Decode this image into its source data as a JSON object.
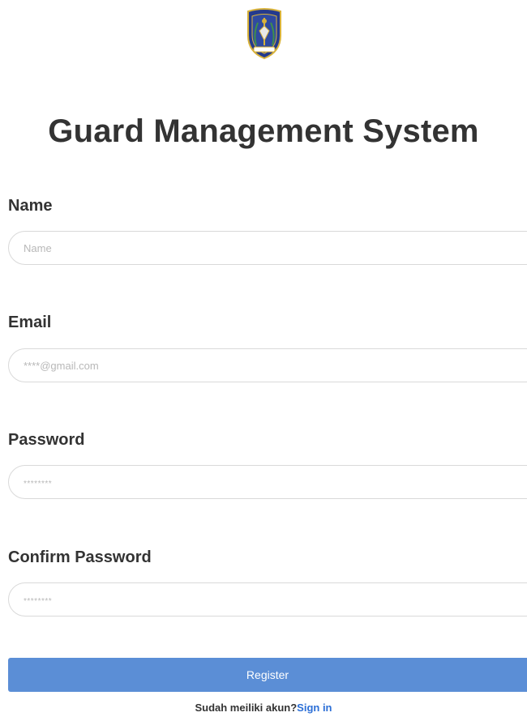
{
  "logo": {
    "icon": "police-shield-emblem-icon",
    "colors": {
      "shield": "#243a8e",
      "gold": "#d8b23a",
      "green": "#3f8f4a"
    }
  },
  "title": "Guard Management System",
  "form": {
    "name": {
      "label": "Name",
      "placeholder": "Name"
    },
    "email": {
      "label": "Email",
      "placeholder": "****@gmail.com"
    },
    "password": {
      "label": "Password",
      "placeholder": "********"
    },
    "confirm_password": {
      "label": "Confirm Password",
      "placeholder": "********"
    },
    "register_label": "Register"
  },
  "footer": {
    "prompt": "Sudah meiliki akun?",
    "signin_label": "Sign in"
  },
  "colors": {
    "accent": "#5b8ed6",
    "link": "#2c6fd6",
    "text": "#333333",
    "input_border": "#d9d9d9"
  }
}
